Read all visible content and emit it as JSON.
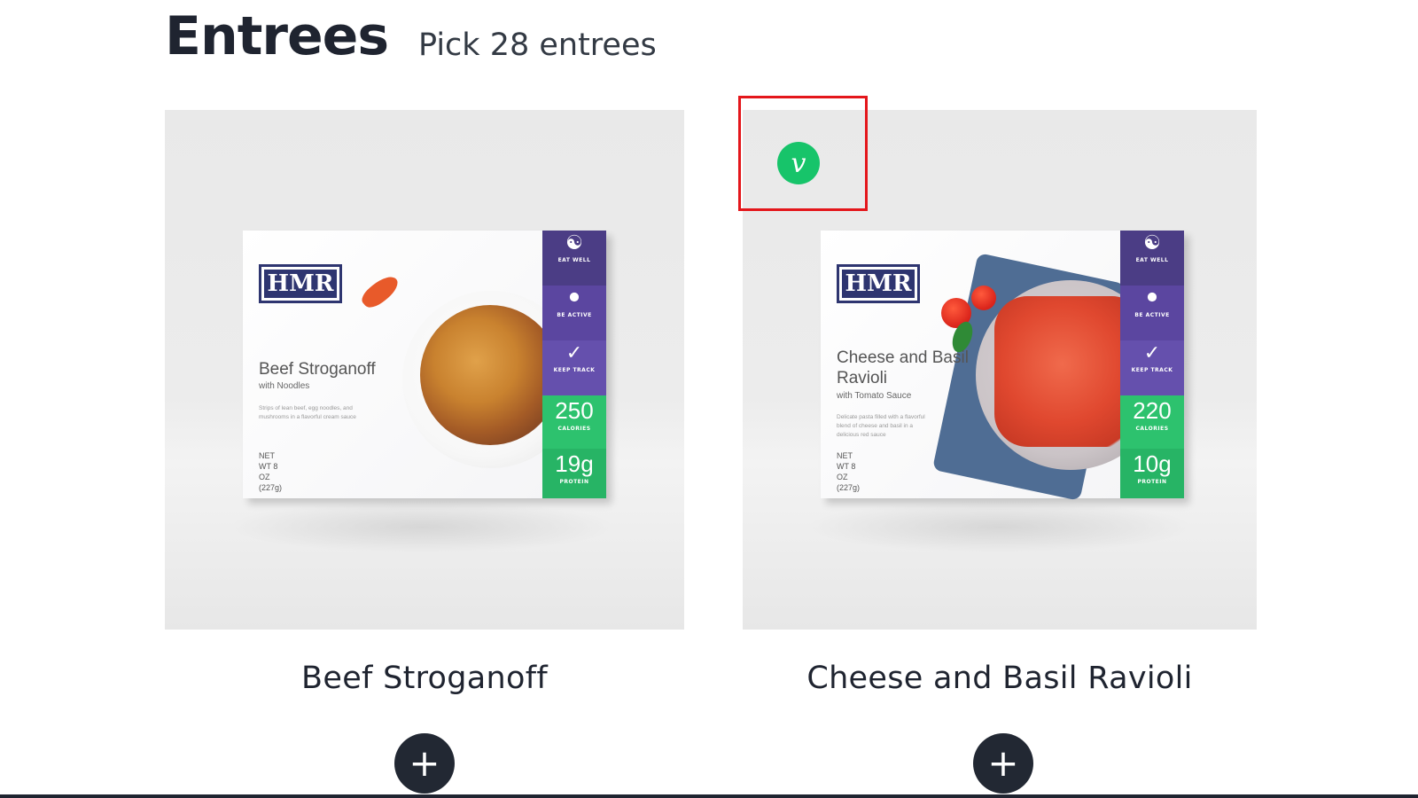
{
  "page": {
    "title": "Entrees",
    "subtitle": "Pick 28 entrees"
  },
  "colors": {
    "text": "#1f2430",
    "veg_badge": "#17c46a",
    "highlight": "#e4161b",
    "add_button": "#222833",
    "hmr_navy": "#2e3570",
    "stripe_purple": "#4e3a86",
    "stripe_green": "#2dc26e"
  },
  "products": [
    {
      "name": "Beef Stroganoff",
      "box": {
        "brand": "HMR",
        "name": "Beef Stroganoff",
        "subtitle": "with Noodles",
        "blurb": "Strips of lean beef, egg noodles, and mushrooms in a flavorful cream sauce",
        "weight": "NET WT 8 OZ (227g)",
        "labels": [
          "EAT WELL",
          "BE ACTIVE",
          "KEEP TRACK"
        ],
        "calories": "250",
        "calories_label": "CALORIES",
        "protein": "19g",
        "protein_label": "PROTEIN"
      },
      "vegetarian": false,
      "add_icon": "plus-icon"
    },
    {
      "name": "Cheese and Basil Ravioli",
      "box": {
        "brand": "HMR",
        "name": "Cheese and Basil Ravioli",
        "subtitle": "with Tomato Sauce",
        "blurb": "Delicate pasta filled with a flavorful blend of cheese and basil in a delicious red sauce",
        "weight": "NET WT 8 OZ (227g)",
        "labels": [
          "EAT WELL",
          "BE ACTIVE",
          "KEEP TRACK"
        ],
        "calories": "220",
        "calories_label": "CALORIES",
        "protein": "10g",
        "protein_label": "PROTEIN"
      },
      "vegetarian": true,
      "veg_badge_text": "v",
      "add_icon": "plus-icon"
    }
  ]
}
